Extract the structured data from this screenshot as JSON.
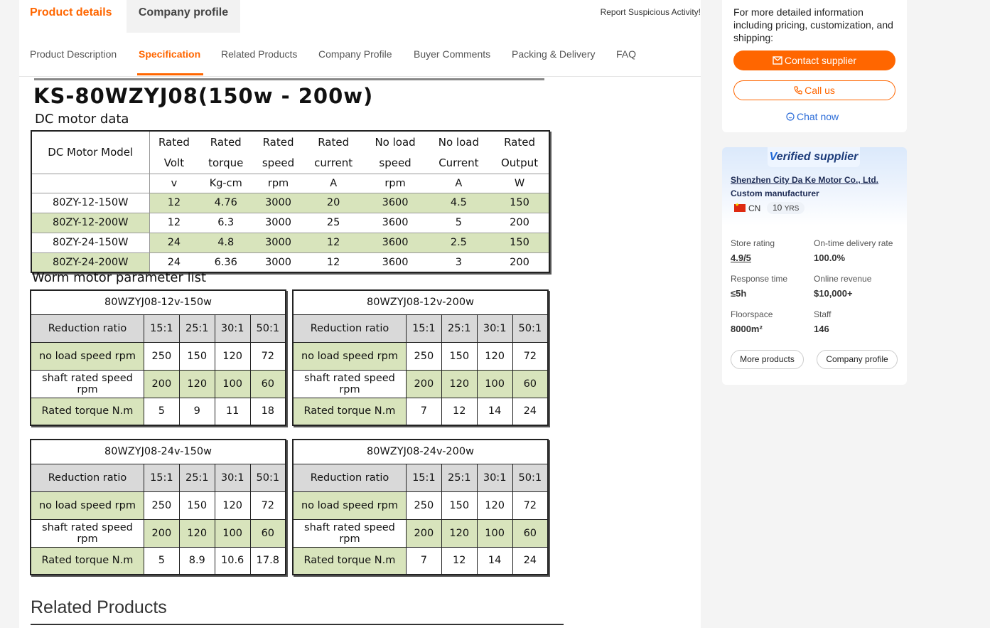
{
  "top_tabs": {
    "active": "Product details",
    "inactive": "Company profile"
  },
  "report_link": "Report Suspicious Activity!",
  "sub_tabs": [
    "Product Description",
    "Specification",
    "Related Products",
    "Company Profile",
    "Buyer Comments",
    "Packing & Delivery",
    "FAQ"
  ],
  "spec": {
    "title": "KS-80WZYJ08(150w - 200w)",
    "dc_subtitle": "DC motor data",
    "dc_table": {
      "model_header": "DC Motor Model",
      "headers_line1": [
        "Rated",
        "Rated",
        "Rated",
        "Rated",
        "No load",
        "No load",
        "Rated"
      ],
      "headers_line2": [
        "Volt",
        "torque",
        "speed",
        "current",
        "speed",
        "Current",
        "Output"
      ],
      "units": [
        "v",
        "Kg-cm",
        "rpm",
        "A",
        "rpm",
        "A",
        "W"
      ],
      "rows": [
        [
          "80ZY-12-150W",
          "12",
          "4.76",
          "3000",
          "20",
          "3600",
          "4.5",
          "150"
        ],
        [
          "80ZY-12-200W",
          "12",
          "6.3",
          "3000",
          "25",
          "3600",
          "5",
          "200"
        ],
        [
          "80ZY-24-150W",
          "24",
          "4.8",
          "3000",
          "12",
          "3600",
          "2.5",
          "150"
        ],
        [
          "80ZY-24-200W",
          "24",
          "6.36",
          "3000",
          "12",
          "3600",
          "3",
          "200"
        ]
      ]
    },
    "worm_subtitle": "Worm  motor parameter list",
    "worm_tables": [
      {
        "title": "80WZYJ08-12v-150w",
        "header_label": "Reduction  ratio",
        "ratios": [
          "15:1",
          "25:1",
          "30:1",
          "50:1"
        ],
        "rows": [
          {
            "label": "no load speed rpm",
            "values": [
              "250",
              "150",
              "120",
              "72"
            ]
          },
          {
            "label": "shaft rated speed rpm",
            "values": [
              "200",
              "120",
              "100",
              "60"
            ]
          },
          {
            "label": "Rated torque N.m",
            "values": [
              "5",
              "9",
              "11",
              "18"
            ]
          }
        ]
      },
      {
        "title": "80WZYJ08-12v-200w",
        "header_label": "Reduction  ratio",
        "ratios": [
          "15:1",
          "25:1",
          "30:1",
          "50:1"
        ],
        "rows": [
          {
            "label": "no load speed rpm",
            "values": [
              "250",
              "150",
              "120",
              "72"
            ]
          },
          {
            "label": "shaft rated speed rpm",
            "values": [
              "200",
              "120",
              "100",
              "60"
            ]
          },
          {
            "label": "Rated torque N.m",
            "values": [
              "7",
              "12",
              "14",
              "24"
            ]
          }
        ]
      },
      {
        "title": "80WZYJ08-24v-150w",
        "header_label": "Reduction ratio",
        "ratios": [
          "15:1",
          "25:1",
          "30:1",
          "50:1"
        ],
        "rows": [
          {
            "label": "no load speed rpm",
            "values": [
              "250",
              "150",
              "120",
              "72"
            ]
          },
          {
            "label": "shaft rated speed rpm",
            "values": [
              "200",
              "120",
              "100",
              "60"
            ]
          },
          {
            "label": "Rated torque N.m",
            "values": [
              "5",
              "8.9",
              "10.6",
              "17.8"
            ]
          }
        ]
      },
      {
        "title": "80WZYJ08-24v-200w",
        "header_label": "Reduction ratio",
        "ratios": [
          "15:1",
          "25:1",
          "30:1",
          "50:1"
        ],
        "rows": [
          {
            "label": "no load speed rpm",
            "values": [
              "250",
              "150",
              "120",
              "72"
            ]
          },
          {
            "label": "shaft rated speed rpm",
            "values": [
              "200",
              "120",
              "100",
              "60"
            ]
          },
          {
            "label": "Rated torque N.m",
            "values": [
              "7",
              "12",
              "14",
              "24"
            ]
          }
        ]
      }
    ]
  },
  "related_products_title": "Related Products",
  "sidebar": {
    "info_text": "For more detailed information including pricing, customization, and shipping:",
    "contact_button": "Contact supplier",
    "call_button": "Call us",
    "chat_link": "Chat now",
    "supplier": {
      "badge_v": "V",
      "badge_text": "erified supplier",
      "name": "Shenzhen City Da Ke Motor Co., Ltd.",
      "type": "Custom manufacturer",
      "country": "CN",
      "years": "10",
      "years_unit": "YRS",
      "stats": [
        {
          "label": "Store rating",
          "value": "4.9/5"
        },
        {
          "label": "On-time delivery rate",
          "value": "100.0%"
        },
        {
          "label": "Response time",
          "value": "≤5h"
        },
        {
          "label": "Online revenue",
          "value": "$10,000+"
        },
        {
          "label": "Floorspace",
          "value": "8000m²"
        },
        {
          "label": "Staff",
          "value": "146"
        }
      ],
      "more_products_button": "More products",
      "company_profile_button": "Company profile"
    }
  },
  "colors": {
    "accent": "#ff6600",
    "table_green": "#d8e4bc",
    "table_gray": "#d9d9d9",
    "link_blue": "#2b6cd8"
  }
}
